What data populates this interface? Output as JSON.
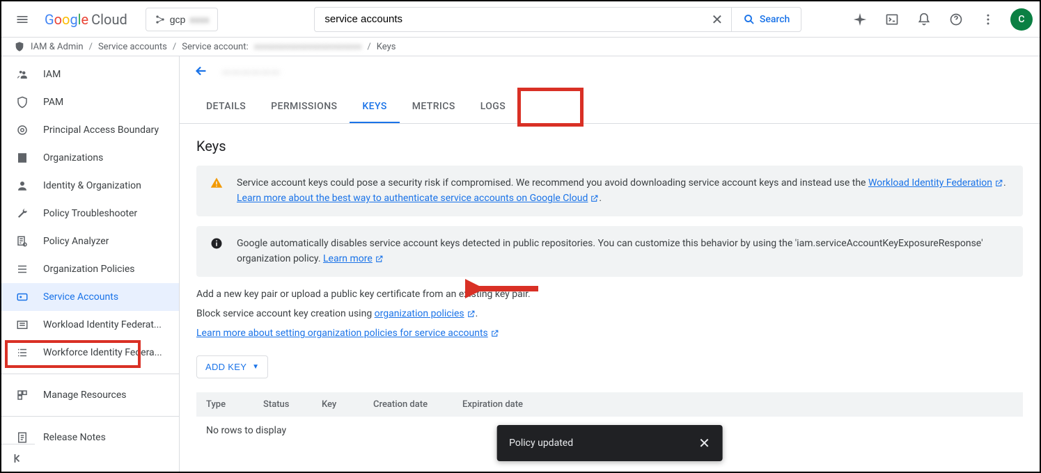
{
  "header": {
    "logo_cloud": "Cloud",
    "project_name": "gcp",
    "search_value": "service accounts",
    "search_button": "Search",
    "avatar_initial": "C"
  },
  "breadcrumb": {
    "items": [
      "IAM & Admin",
      "Service accounts",
      "Service account:",
      "Keys"
    ]
  },
  "sidebar": {
    "items": [
      {
        "label": "IAM"
      },
      {
        "label": "PAM"
      },
      {
        "label": "Principal Access Boundary"
      },
      {
        "label": "Organizations"
      },
      {
        "label": "Identity & Organization"
      },
      {
        "label": "Policy Troubleshooter"
      },
      {
        "label": "Policy Analyzer"
      },
      {
        "label": "Organization Policies"
      },
      {
        "label": "Service Accounts"
      },
      {
        "label": "Workload Identity Federat..."
      },
      {
        "label": "Workforce Identity Federa..."
      },
      {
        "label": "Manage Resources"
      },
      {
        "label": "Release Notes"
      }
    ]
  },
  "page": {
    "title": "——————",
    "tabs": [
      "DETAILS",
      "PERMISSIONS",
      "KEYS",
      "METRICS",
      "LOGS"
    ],
    "heading": "Keys",
    "warn_text": "Service account keys could pose a security risk if compromised. We recommend you avoid downloading service account keys and instead use the ",
    "warn_link1": "Workload Identity Federation",
    "warn_sep": ". ",
    "warn_link2": "Learn more about the best way to authenticate service accounts on Google Cloud",
    "warn_end": ".",
    "info_text": "Google automatically disables service account keys detected in public repositories. You can customize this behavior by using the 'iam.serviceAccountKeyExposureResponse' organization policy. ",
    "info_link": "Learn more",
    "p1": "Add a new key pair or upload a public key certificate from an existing key pair.",
    "p2_pre": "Block service account key creation using ",
    "p2_link": "organization policies",
    "p2_end": ".",
    "p3_link": "Learn more about setting organization policies for service accounts",
    "add_key": "ADD KEY",
    "table_headers": {
      "type": "Type",
      "status": "Status",
      "key": "Key",
      "cdate": "Creation date",
      "edate": "Expiration date"
    },
    "empty": "No rows to display"
  },
  "toast": {
    "message": "Policy updated"
  }
}
